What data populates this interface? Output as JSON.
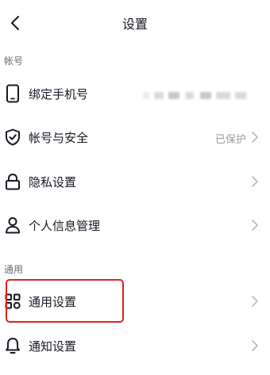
{
  "header": {
    "title": "设置"
  },
  "sections": [
    {
      "label": "帐号"
    },
    {
      "label": "通用"
    }
  ],
  "rows": [
    {
      "label": "绑定手机号",
      "value": "",
      "icon": "phone-icon"
    },
    {
      "label": "帐号与安全",
      "value": "已保护",
      "icon": "shield-check-icon"
    },
    {
      "label": "隐私设置",
      "value": "",
      "icon": "lock-icon"
    },
    {
      "label": "个人信息管理",
      "value": "",
      "icon": "person-icon"
    },
    {
      "label": "通用设置",
      "value": "",
      "icon": "grid-icon"
    },
    {
      "label": "通知设置",
      "value": "",
      "icon": "bell-icon"
    }
  ],
  "colors": {
    "highlight": "#e02020",
    "text": "#161823",
    "muted": "#9a9a9a"
  }
}
